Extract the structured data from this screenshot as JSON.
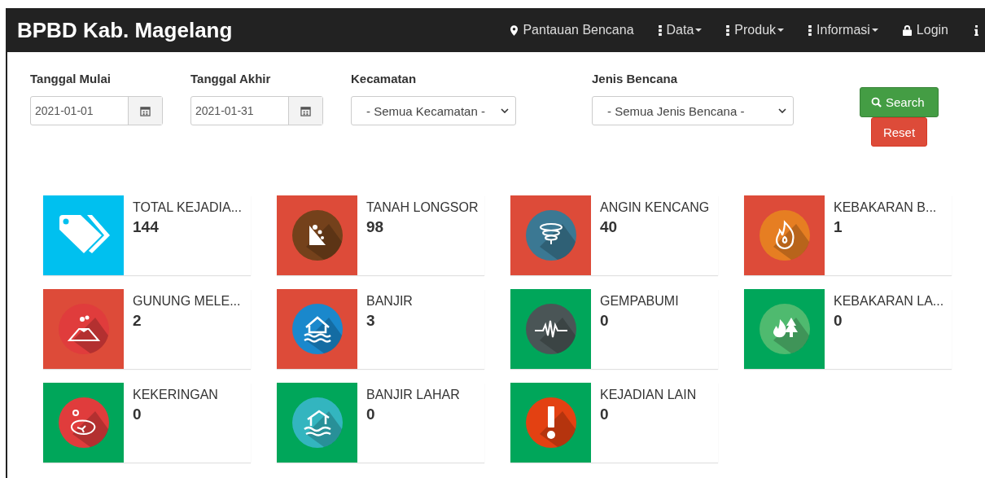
{
  "navbar": {
    "brand": "BPBD Kab. Magelang",
    "items": [
      {
        "label": "Pantauan Bencana",
        "kind": "pin",
        "dropdown": false
      },
      {
        "label": "Data",
        "kind": "dots",
        "dropdown": true
      },
      {
        "label": "Produk",
        "kind": "dots",
        "dropdown": true
      },
      {
        "label": "Informasi",
        "kind": "dots",
        "dropdown": true
      },
      {
        "label": "Login",
        "kind": "lock",
        "dropdown": false
      },
      {
        "kind": "info",
        "dropdown": false
      }
    ]
  },
  "filters": {
    "start_date": {
      "label": "Tanggal Mulai",
      "value": "2021-01-01"
    },
    "end_date": {
      "label": "Tanggal Akhir",
      "value": "2021-01-31"
    },
    "district": {
      "label": "Kecamatan",
      "value": "- Semua Kecamatan -"
    },
    "disaster_type": {
      "label": "Jenis Bencana",
      "value": "- Semua Jenis Bencana -"
    },
    "buttons": [
      "Search",
      "Reset"
    ]
  },
  "cards": [
    {
      "title": "TOTAL KEJADIA...",
      "count": "144",
      "color": "#00c0ef",
      "kind": "tag"
    },
    {
      "title": "TANAH LONGSOR",
      "count": "98",
      "color": "#dd4b39",
      "kind": "landslide"
    },
    {
      "title": "ANGIN KENCANG",
      "count": "40",
      "color": "#dd4b39",
      "kind": "tornado"
    },
    {
      "title": "KEBAKARAN B...",
      "count": "1",
      "color": "#dd4b39",
      "kind": "fire"
    },
    {
      "title": "GUNUNG MELE...",
      "count": "2",
      "color": "#dd4b39",
      "kind": "volcano"
    },
    {
      "title": "BANJIR",
      "count": "3",
      "color": "#dd4b39",
      "kind": "flood"
    },
    {
      "title": "GEMPABUMI",
      "count": "0",
      "color": "#00a65a",
      "kind": "quake"
    },
    {
      "title": "KEBAKARAN LA...",
      "count": "0",
      "color": "#00a65a",
      "kind": "forestfire"
    },
    {
      "title": "KEKERINGAN",
      "count": "0",
      "color": "#00a65a",
      "kind": "drought"
    },
    {
      "title": "BANJIR LAHAR",
      "count": "0",
      "color": "#00a65a",
      "kind": "lahar"
    },
    {
      "title": "KEJADIAN LAIN",
      "count": "0",
      "color": "#00a65a",
      "kind": "alert"
    }
  ]
}
